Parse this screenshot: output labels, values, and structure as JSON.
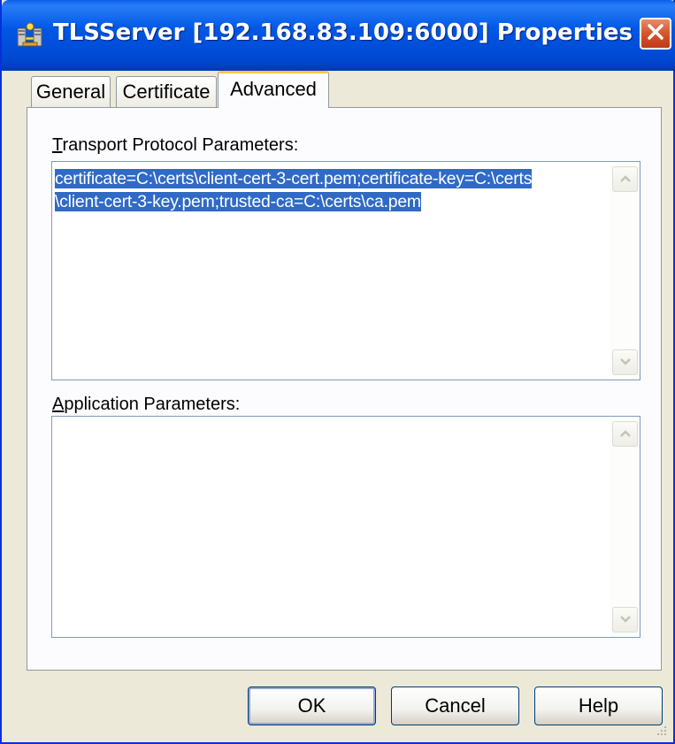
{
  "window": {
    "title": "TLSServer [192.168.83.109:6000] Properties",
    "icon": "server-icon",
    "close_icon": "close-icon"
  },
  "tabs": [
    {
      "label": "General",
      "active": false
    },
    {
      "label": "Certificate",
      "active": false
    },
    {
      "label": "Advanced",
      "active": true
    }
  ],
  "transport": {
    "label_mnemonic": "T",
    "label_rest": "ransport Protocol Parameters:",
    "lines": [
      "certificate=C:\\certs\\client-cert-3-cert.pem;certificate-key=C:\\certs",
      "\\client-cert-3-key.pem;trusted-ca=C:\\certs\\ca.pem"
    ]
  },
  "application": {
    "label_mnemonic": "A",
    "label_rest": "pplication Parameters:",
    "value": ""
  },
  "buttons": {
    "ok": "OK",
    "cancel": "Cancel",
    "help": "Help"
  },
  "colors": {
    "titlebar": "#0058e6",
    "selection": "#316ac5",
    "active_tab_highlight": "#ffc83c",
    "close_button": "#d5542d"
  }
}
